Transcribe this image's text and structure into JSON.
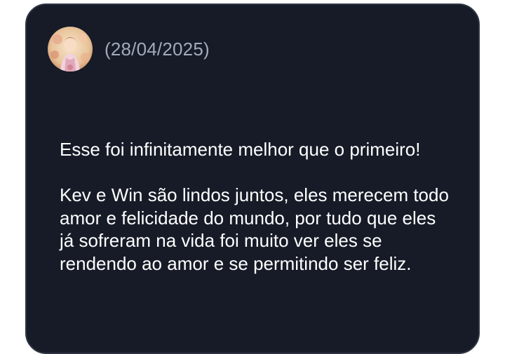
{
  "review": {
    "date": "(28/04/2025)",
    "paragraphs": [
      "Esse foi infinitamente melhor que o primeiro!",
      "Kev e Win são lindos juntos, eles merecem todo amor e felicidade do mundo, por tudo que eles já sofreram na vida foi muito ver eles se rendendo ao amor e se permitindo ser feliz."
    ]
  },
  "colors": {
    "card_background": "#161b27",
    "card_border": "#2e3442",
    "date_text": "#a3aab8",
    "body_text": "#ffffff"
  }
}
